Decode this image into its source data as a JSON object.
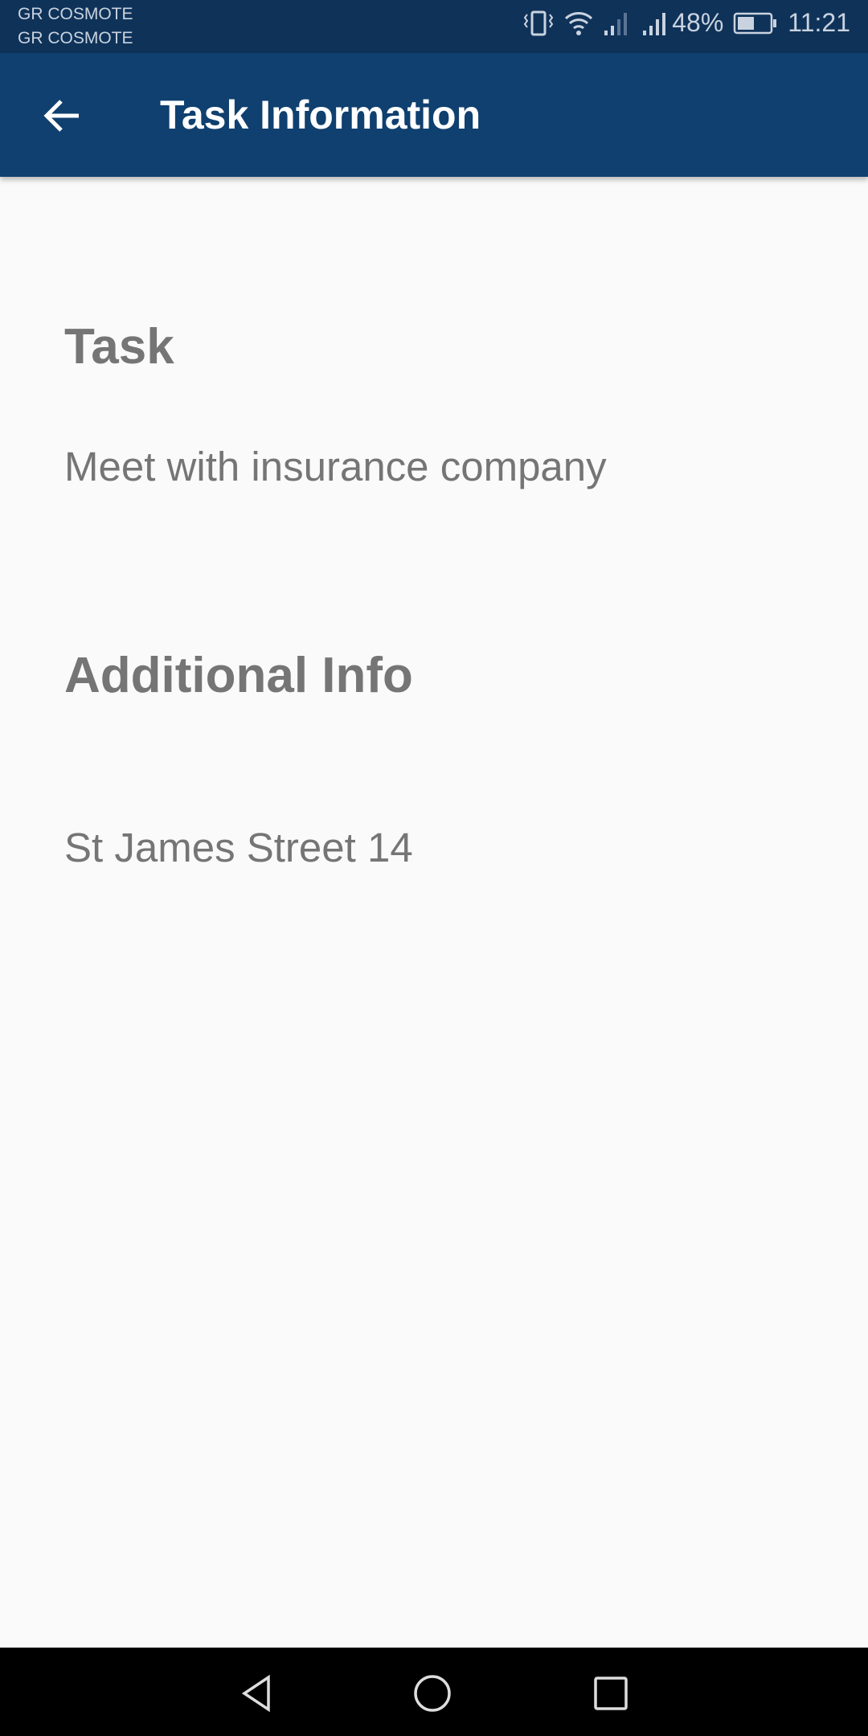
{
  "status_bar": {
    "carrier_1": "GR COSMOTE",
    "carrier_2": "GR COSMOTE",
    "battery": "48%",
    "time": "11:21"
  },
  "app_bar": {
    "title": "Task Information"
  },
  "content": {
    "task_heading": "Task",
    "task_value": "Meet with insurance company",
    "info_heading": "Additional Info",
    "info_value": "St James Street 14"
  },
  "colors": {
    "app_bar": "#0f406f",
    "status_bar": "#0f3259",
    "text": "#757575"
  }
}
